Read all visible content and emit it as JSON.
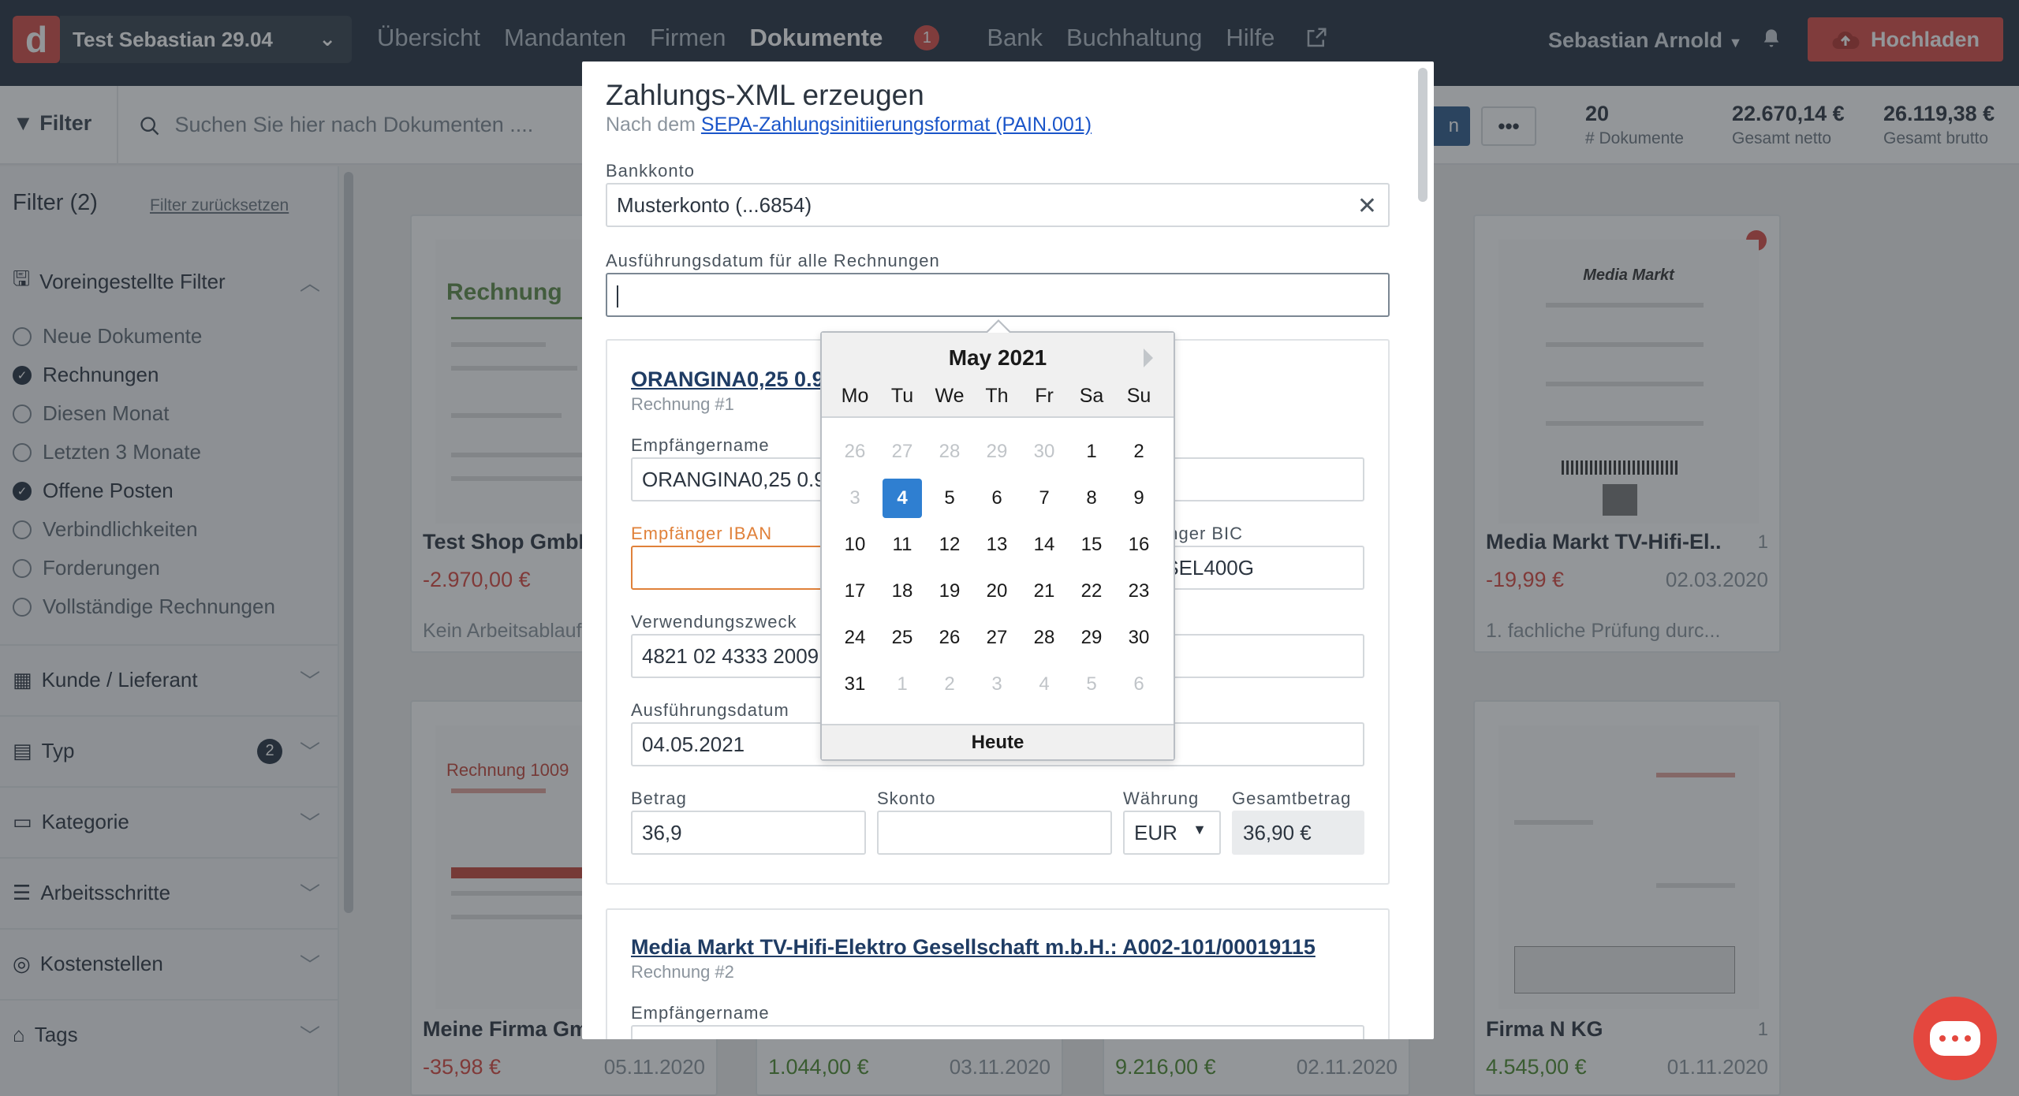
{
  "header": {
    "workspace": "Test Sebastian 29.04",
    "nav": [
      {
        "label": "Übersicht"
      },
      {
        "label": "Mandanten"
      },
      {
        "label": "Firmen"
      },
      {
        "label": "Dokumente",
        "badge": "1"
      },
      {
        "label": "Bank"
      },
      {
        "label": "Buchhaltung"
      },
      {
        "label": "Hilfe"
      }
    ],
    "user": "Sebastian Arnold",
    "upload_label": "Hochladen"
  },
  "toolbar": {
    "filter_label": "Filter",
    "search_placeholder": "Suchen Sie hier nach Dokumenten ....",
    "partial_button": "n",
    "more": "•••",
    "stats": [
      {
        "value": "20",
        "label": "# Dokumente"
      },
      {
        "value": "22.670,14 €",
        "label": "Gesamt netto"
      },
      {
        "value": "26.119,38 €",
        "label": "Gesamt brutto"
      }
    ]
  },
  "sidebar": {
    "title": "Filter (2)",
    "reset": "Filter zurücksetzen",
    "preset_title": "Voreingestellte Filter",
    "presets": [
      {
        "label": "Neue Dokumente",
        "checked": false
      },
      {
        "label": "Rechnungen",
        "checked": true
      },
      {
        "label": "Diesen Monat",
        "checked": false
      },
      {
        "label": "Letzten 3 Monate",
        "checked": false
      },
      {
        "label": "Offene Posten",
        "checked": true
      },
      {
        "label": "Verbindlichkeiten",
        "checked": false
      },
      {
        "label": "Forderungen",
        "checked": false
      },
      {
        "label": "Vollständige Rechnungen",
        "checked": false
      }
    ],
    "sections": [
      {
        "label": "Kunde / Lieferant"
      },
      {
        "label": "Typ",
        "badge": "2"
      },
      {
        "label": "Kategorie"
      },
      {
        "label": "Arbeitsschritte"
      },
      {
        "label": "Kostenstellen"
      },
      {
        "label": "Tags"
      }
    ]
  },
  "cards": [
    {
      "doc_label": "Rechnung",
      "title": "Test Shop GmbH",
      "amount": "-2.970,00 €",
      "sub": "Kein Arbeitsablauf"
    },
    {
      "doc_label": "",
      "title": "Media Markt TV-Hifi-El...",
      "amount": "-19,99 €",
      "date": "02.03.2020",
      "pages": "1",
      "sub": "1. fachliche Prüfung durc..."
    },
    {
      "doc_label": "Rechnung 1009",
      "title": "Meine Firma Gm",
      "amount": "-35,98 €",
      "date": "05.11.2020"
    },
    {
      "title": "",
      "amount": "1.044,00 €",
      "date": "03.11.2020"
    },
    {
      "title": "",
      "amount": "9.216,00 €",
      "date": "02.11.2020"
    },
    {
      "title": "Firma N KG",
      "amount": "4.545,00 €",
      "date": "01.11.2020",
      "pages": "1"
    }
  ],
  "modal": {
    "title": "Zahlungs-XML erzeugen",
    "subtitle_prefix": "Nach dem",
    "subtitle_link": "SEPA-Zahlungsinitiierungsformat (PAIN.001)",
    "bank_label": "Bankkonto",
    "bank_value": "Musterkonto (...6854)",
    "exec_all_label": "Ausführungsdatum für alle Rechnungen",
    "exec_all_value": "",
    "invoice1": {
      "title": "ORANGINA0,25 0.9",
      "sub": "Rechnung #1",
      "recipient_label": "Empfängername",
      "recipient_value": "ORANGINA0,25 0.9",
      "iban_label": "Empfänger IBAN",
      "iban_value": "",
      "bic_label": "änger BIC",
      "bic_value": "ISEL400G",
      "purpose_label": "Verwendungszweck",
      "purpose_value": "4821 02 4333 2009",
      "exec_label": "Ausführungsdatum",
      "exec_value": "04.05.2021",
      "amount_label": "Betrag",
      "amount_value": "36,9",
      "skonto_label": "Skonto",
      "skonto_value": "",
      "currency_label": "Währung",
      "currency_value": "EUR",
      "total_label": "Gesamtbetrag",
      "total_value": "36,90 €"
    },
    "invoice2": {
      "title": "Media Markt TV-Hifi-Elektro Gesellschaft m.b.H.: A002-101/00019115",
      "sub": "Rechnung #2",
      "recipient_label": "Empfängername"
    }
  },
  "datepicker": {
    "month": "May 2021",
    "weekdays": [
      "Mo",
      "Tu",
      "We",
      "Th",
      "Fr",
      "Sa",
      "Su"
    ],
    "weeks": [
      [
        "26",
        "27",
        "28",
        "29",
        "30",
        "1",
        "2"
      ],
      [
        "3",
        "4",
        "5",
        "6",
        "7",
        "8",
        "9"
      ],
      [
        "10",
        "11",
        "12",
        "13",
        "14",
        "15",
        "16"
      ],
      [
        "17",
        "18",
        "19",
        "20",
        "21",
        "22",
        "23"
      ],
      [
        "24",
        "25",
        "26",
        "27",
        "28",
        "29",
        "30"
      ],
      [
        "31",
        "1",
        "2",
        "3",
        "4",
        "5",
        "6"
      ]
    ],
    "selected": "4",
    "today_label": "Heute"
  }
}
